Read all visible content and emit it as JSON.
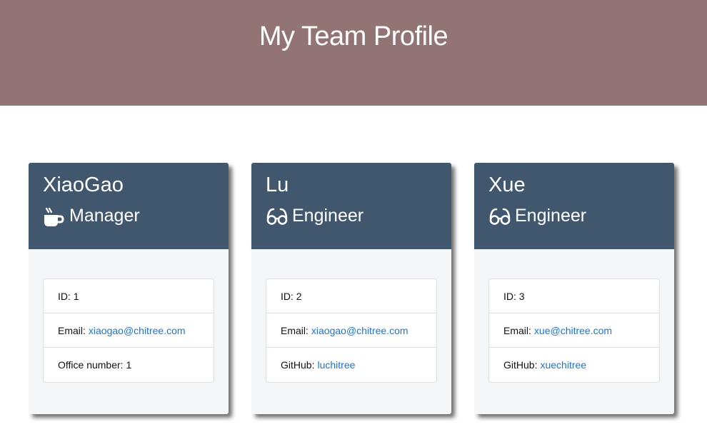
{
  "header": {
    "title": "My Team Profile"
  },
  "team": [
    {
      "name": "XiaoGao",
      "role": "Manager",
      "role_icon": "mug-hot-icon",
      "id_label": "ID:",
      "id": "1",
      "email_label": "Email:",
      "email": "xiaogao@chitree.com",
      "extra_label": "Office number:",
      "extra_value": "1"
    },
    {
      "name": "Lu",
      "role": "Engineer",
      "role_icon": "glasses-icon",
      "id_label": "ID:",
      "id": "2",
      "email_label": "Email:",
      "email": "xiaogao@chitree.com",
      "extra_label": "GitHub:",
      "extra_value": "luchitree"
    },
    {
      "name": "Xue",
      "role": "Engineer",
      "role_icon": "glasses-icon",
      "id_label": "ID:",
      "id": "3",
      "email_label": "Email:",
      "email": "xue@chitree.com",
      "extra_label": "GitHub:",
      "extra_value": "xuechitree"
    }
  ],
  "colors": {
    "header_bg": "#927474",
    "card_head_bg": "#41576e",
    "link": "#1a73e8"
  }
}
